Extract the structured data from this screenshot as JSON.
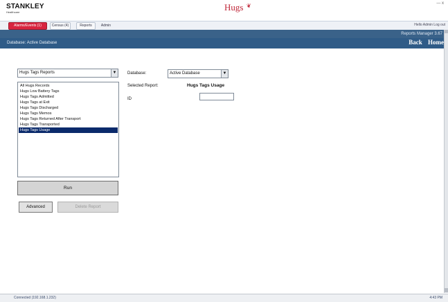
{
  "header": {
    "brand": "STANKLEY",
    "brand_sub": "Healthcare",
    "product": "Hugs",
    "product_mark": "❦",
    "window_controls": "— x"
  },
  "tabs": [
    {
      "label": "Alarms/Events (1)"
    },
    {
      "label": "Census (4)"
    },
    {
      "label": "Reports"
    },
    {
      "label": "Admin"
    }
  ],
  "user_links": "Hello Admin  Log out",
  "reports_manager": "Reports Manager 3.67",
  "database_bar": {
    "label": "Database: Active Database",
    "back": "Back",
    "home": "Home"
  },
  "report_select": {
    "value": "Hugs Tags Reports",
    "arrow": "▼"
  },
  "report_list": {
    "items": [
      "All Hugs Records",
      "Hugs Low Battery Tags",
      "Hugs Tags Admitted",
      "Hugs Tags at Exit",
      "Hugs Tags Discharged",
      "Hugs Tags Memos",
      "Hugs Tags Returned After Transport",
      "Hugs Tags Transported",
      "Hugs Tags Usage"
    ],
    "selected_index": 8
  },
  "buttons": {
    "run": "Run",
    "advanced": "Advanced",
    "delete": "Delete Report"
  },
  "form": {
    "database_label": "Database:",
    "database_value": "Active Database",
    "database_arrow": "▼",
    "selected_report_label": "Selected Report:",
    "selected_report_value": "Hugs Tags Usage",
    "id_label": "ID",
    "id_value": ""
  },
  "status": {
    "left": "Connected (192.168.1.232)",
    "right": "4:43 PM"
  },
  "colors": {
    "bar_blue": "#2f5b87",
    "alarm_tab": "#d8243f",
    "selected_row": "#0a2a6b",
    "brand_red": "#c0283a"
  }
}
